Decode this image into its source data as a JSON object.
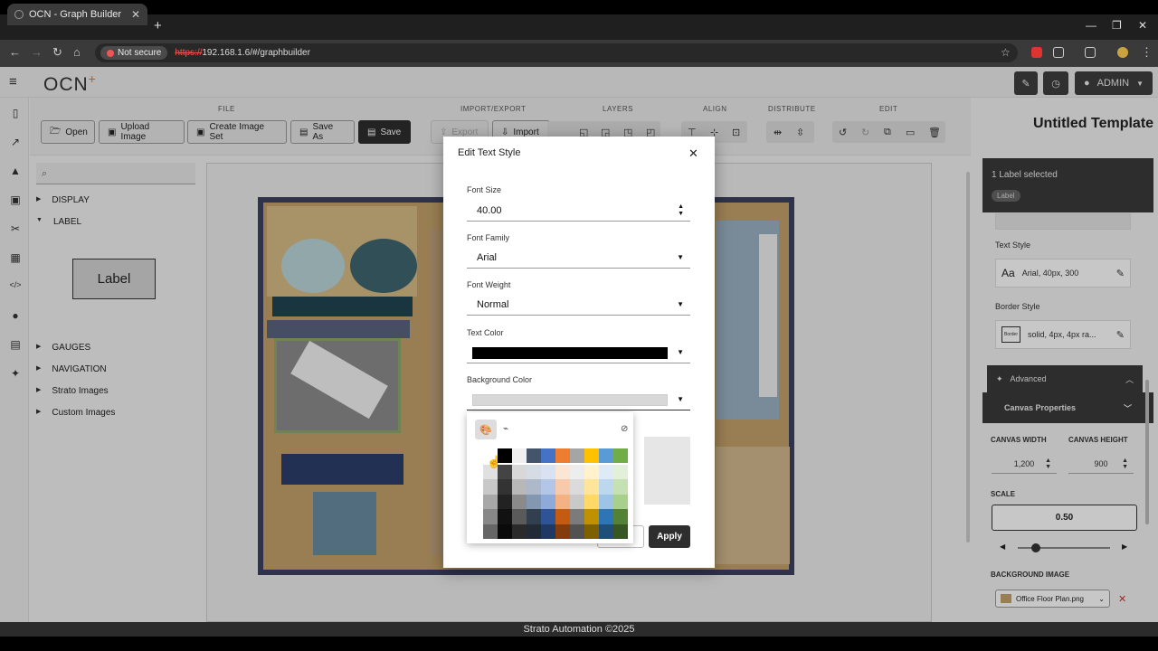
{
  "browser": {
    "tab_title": "OCN - Graph Builder",
    "not_secure": "Not secure",
    "url_proto": "https://",
    "url_rest": "192.168.1.6/#/graphbuilder"
  },
  "header": {
    "logo": "OCN",
    "logo_plus": "+",
    "user": "ADMIN"
  },
  "toolbar": {
    "groups": {
      "file": "FILE",
      "import_export": "IMPORT/EXPORT",
      "layers": "LAYERS",
      "align": "ALIGN",
      "distribute": "DISTRIBUTE",
      "edit": "EDIT"
    },
    "open": "Open",
    "upload_image": "Upload Image",
    "create_image_set": "Create Image Set",
    "save_as": "Save As",
    "save": "Save",
    "export": "Export",
    "import": "Import",
    "template_title": "Untitled Template"
  },
  "left_panel": {
    "search_placeholder": "",
    "display": "DISPLAY",
    "label": "LABEL",
    "label_preview": "Label",
    "gauges": "GAUGES",
    "navigation": "NAVIGATION",
    "strato_images": "Strato Images",
    "custom_images": "Custom Images"
  },
  "right_panel": {
    "selected": "1 Label selected",
    "chip": "Label",
    "text_style_label": "Text Style",
    "text_style_icon": "Aa",
    "text_style_value": "Arial, 40px, 300",
    "border_style_label": "Border Style",
    "border_style_icon": "Border",
    "border_style_value": "solid, 4px, 4px ra...",
    "advanced": "Advanced",
    "canvas_properties": "Canvas Properties",
    "canvas_width_label": "CANVAS WIDTH",
    "canvas_height_label": "CANVAS HEIGHT",
    "canvas_width": "1,200",
    "canvas_height": "900",
    "scale_label": "SCALE",
    "scale": "0.50",
    "scale_slider_fraction": 0.2,
    "background_image_label": "BACKGROUND IMAGE",
    "background_image": "Office Floor Plan.png"
  },
  "modal": {
    "title": "Edit Text Style",
    "font_size_label": "Font Size",
    "font_size": "40.00",
    "font_family_label": "Font Family",
    "font_family": "Arial",
    "font_weight_label": "Font Weight",
    "font_weight": "Normal",
    "text_color_label": "Text Color",
    "text_color": "#000000",
    "background_color_label": "Background Color",
    "background_color": "#d8d8d8",
    "apply": "Apply"
  },
  "palette": {
    "columns": [
      [
        "#ffffff",
        "#e0e0e0",
        "#c8c8c8",
        "#a8a8a8",
        "#888888",
        "#666666"
      ],
      [
        "#000000",
        "#444444",
        "#333333",
        "#222222",
        "#111111",
        "#0a0a0a"
      ],
      [
        "#f0f0f0",
        "#d8d8d8",
        "#b8b8b8",
        "#8a8a8a",
        "#5a5a5a",
        "#2a2a2a"
      ],
      [
        "#44546a",
        "#d6dce4",
        "#adb9ca",
        "#8497b0",
        "#323f4f",
        "#222a35"
      ],
      [
        "#4472c4",
        "#d9e2f3",
        "#b4c6e7",
        "#8eaadb",
        "#2f5496",
        "#1f3864"
      ],
      [
        "#ed7d31",
        "#fbe5d5",
        "#f7caac",
        "#f4b183",
        "#c55a11",
        "#833c0b"
      ],
      [
        "#a5a5a5",
        "#ededed",
        "#dbdbdb",
        "#c9c9c9",
        "#7b7b7b",
        "#525252"
      ],
      [
        "#ffc000",
        "#fff2cc",
        "#ffe599",
        "#ffd966",
        "#bf9000",
        "#7f6000"
      ],
      [
        "#5b9bd5",
        "#deebf6",
        "#bdd7ee",
        "#9dc3e6",
        "#2e75b5",
        "#1e4e79"
      ],
      [
        "#70ad47",
        "#e2efd9",
        "#c5e0b3",
        "#a8d08d",
        "#538135",
        "#375623"
      ]
    ]
  },
  "footer": "Strato Automation ©2025"
}
